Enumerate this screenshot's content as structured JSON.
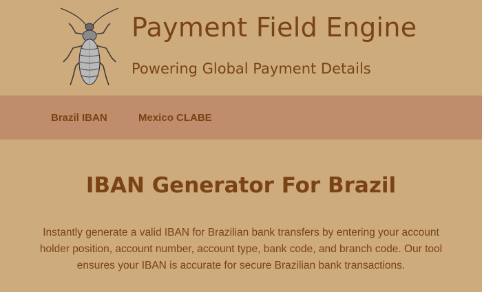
{
  "header": {
    "logo_icon": "beetle-icon",
    "title": "Payment Field Engine",
    "subtitle": "Powering Global Payment Details"
  },
  "nav": {
    "items": [
      {
        "label": "Brazil IBAN"
      },
      {
        "label": "Mexico CLABE"
      }
    ]
  },
  "main": {
    "heading": "IBAN Generator For Brazil",
    "intro": "Instantly generate a valid IBAN for Brazilian bank transfers by entering your account holder position, account number, account type, bank code, and branch code. Our tool ensures your IBAN is accurate for secure Brazilian bank transactions."
  },
  "colors": {
    "background": "#cdab7c",
    "nav_background": "#c08d6c",
    "text": "#7a4315"
  }
}
